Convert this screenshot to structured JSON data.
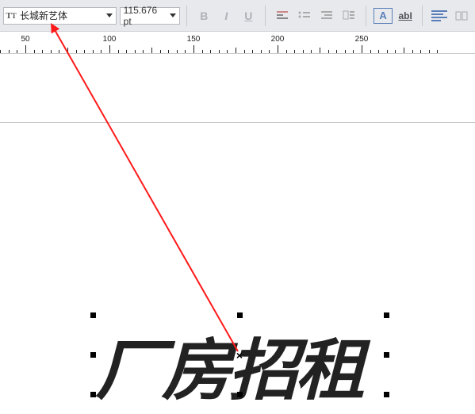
{
  "toolbar": {
    "font_name": "长城新艺体",
    "font_size": "115.676 pt",
    "btn_bold": "B",
    "btn_italic": "I",
    "btn_underline": "U",
    "btn_boxA": "A",
    "btn_ab": "abI"
  },
  "ruler": {
    "labels": [
      "50",
      "100",
      "150",
      "200",
      "250"
    ]
  },
  "canvas": {
    "text": "厂房招租"
  }
}
